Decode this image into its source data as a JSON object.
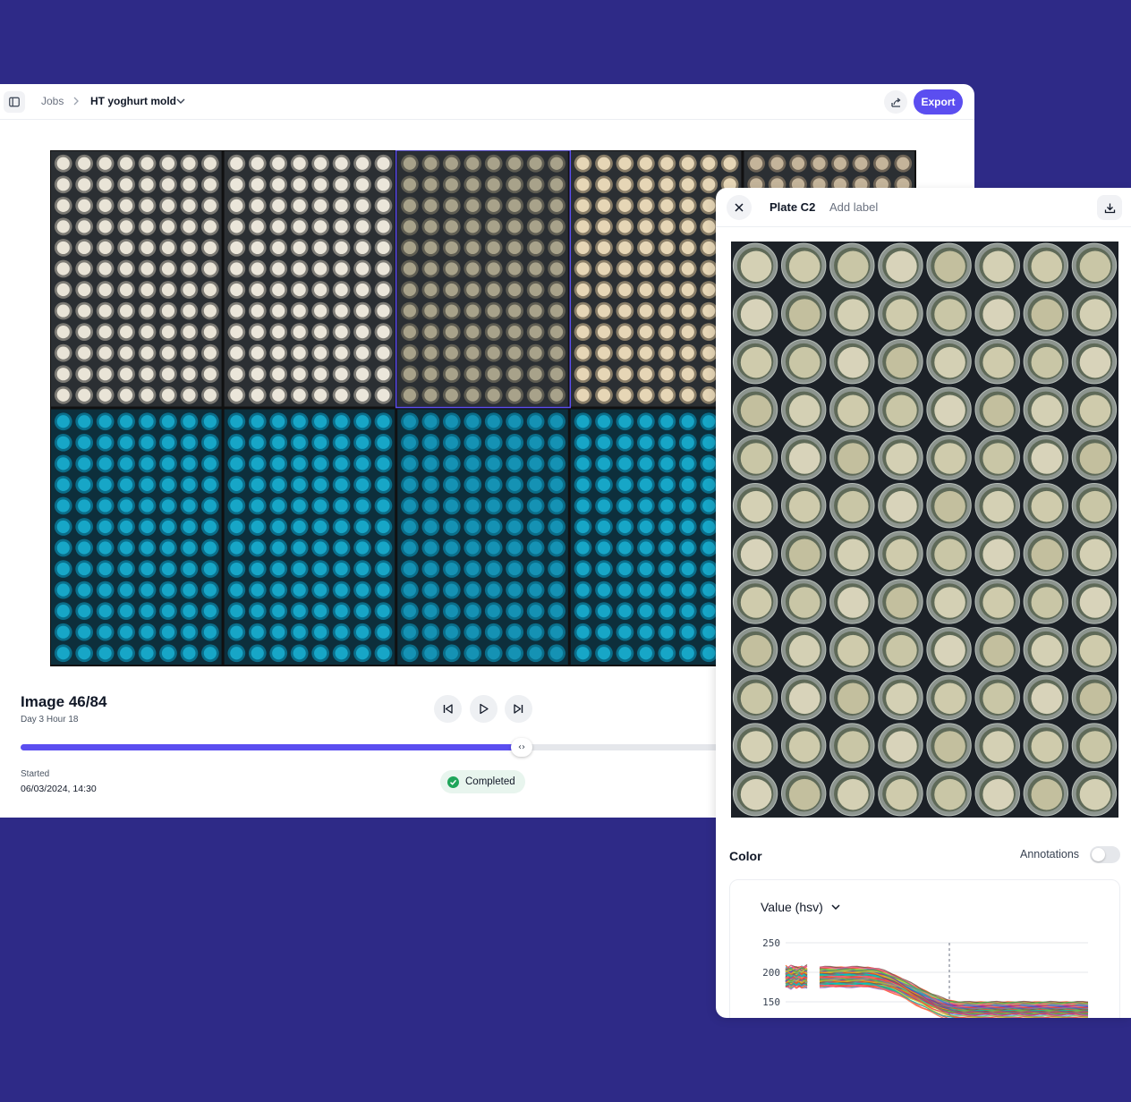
{
  "header": {
    "breadcrumb_root": "Jobs",
    "job_name": "HT yoghurt mold",
    "export_label": "Export"
  },
  "viewer": {
    "image_title": "Image 46/84",
    "image_subtitle": "Day 3 Hour 18",
    "progress": 0.7,
    "started_label": "Started",
    "started_value": "06/03/2024, 14:30",
    "status": "Completed",
    "selected_plate_column": 2,
    "selected_plate_row": 0
  },
  "panel": {
    "plate_title": "Plate C2",
    "add_label": "Add label",
    "color_heading": "Color",
    "annotations_label": "Annotations",
    "annotations_on": false,
    "metric": "Value (hsv)"
  },
  "chart_data": {
    "type": "line",
    "title": "",
    "xlabel": "",
    "ylabel": "",
    "y_ticks": [
      250,
      200,
      150
    ],
    "ylim": [
      130,
      260
    ],
    "grid": true,
    "series_count": 96,
    "band": {
      "start_mean": 192,
      "end_mean": 140,
      "spread_start": 15,
      "spread_end": 8
    }
  },
  "colors": {
    "accent": "#5b4ef0",
    "background": "#2e2a87",
    "cyan_plate": "#17a6c7",
    "status_green": "#1fa55a"
  }
}
